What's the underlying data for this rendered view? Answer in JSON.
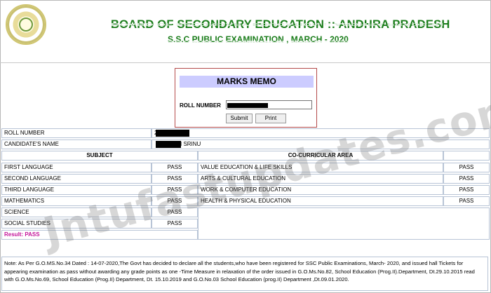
{
  "header": {
    "board_title": "BOARD OF SECONDARY EDUCATION :: ANDHRA PRADESH",
    "exam_title": "S.S.C PUBLIC EXAMINATION , MARCH - 2020"
  },
  "memo": {
    "title": "MARKS MEMO",
    "roll_label": "ROLL NUMBER",
    "submit_label": "Submit",
    "print_label": "Print"
  },
  "student": {
    "roll_label": "ROLL NUMBER",
    "roll_value_visible": "2",
    "name_label": "CANDIDATE'S NAME",
    "name_value_visible": "I SRINU"
  },
  "subjects_header": "SUBJECT",
  "co_header": "CO-CURRICULAR AREA",
  "subjects": [
    {
      "name": "FIRST LANGUAGE",
      "result": "PASS"
    },
    {
      "name": "SECOND LANGUAGE",
      "result": "PASS"
    },
    {
      "name": "THIRD LANGUAGE",
      "result": "PASS"
    },
    {
      "name": "MATHEMATICS",
      "result": "PASS"
    },
    {
      "name": "SCIENCE",
      "result": "PASS"
    },
    {
      "name": "SOCIAL STUDIES",
      "result": "PASS"
    }
  ],
  "co_curricular": [
    {
      "name": "VALUE EDUCATION & LIFE SKILLS",
      "result": "PASS"
    },
    {
      "name": "ARTS & CULTURAL EDUCATION",
      "result": "PASS"
    },
    {
      "name": "WORK & COMPUTER EDUCATION",
      "result": "PASS"
    },
    {
      "name": "HEALTH & PHYSICAL EDUCATION",
      "result": "PASS"
    }
  ],
  "result_text": "Result: PASS",
  "note": "Note: As Per G.O.MS.No.34 Dated : 14-07-2020,The Govt has decided to declare all the students,who have been registered for SSC Public Examinations, March- 2020, and issued hall Tickets for appearing examination as pass without awarding any grade points as one -Time Measure in relaxation of the order issued in G.O.Ms.No.82, School Education (Prog.II).Department, Dt.29.10.2015 read with G.O.Ms.No.69, School Education (Prog.II) Department, Dt. 15.10.2019 and G.O.No.03 School Education (prog.II) Department ,Dt.09.01.2020.",
  "watermark": "Jntufastupdates.com"
}
